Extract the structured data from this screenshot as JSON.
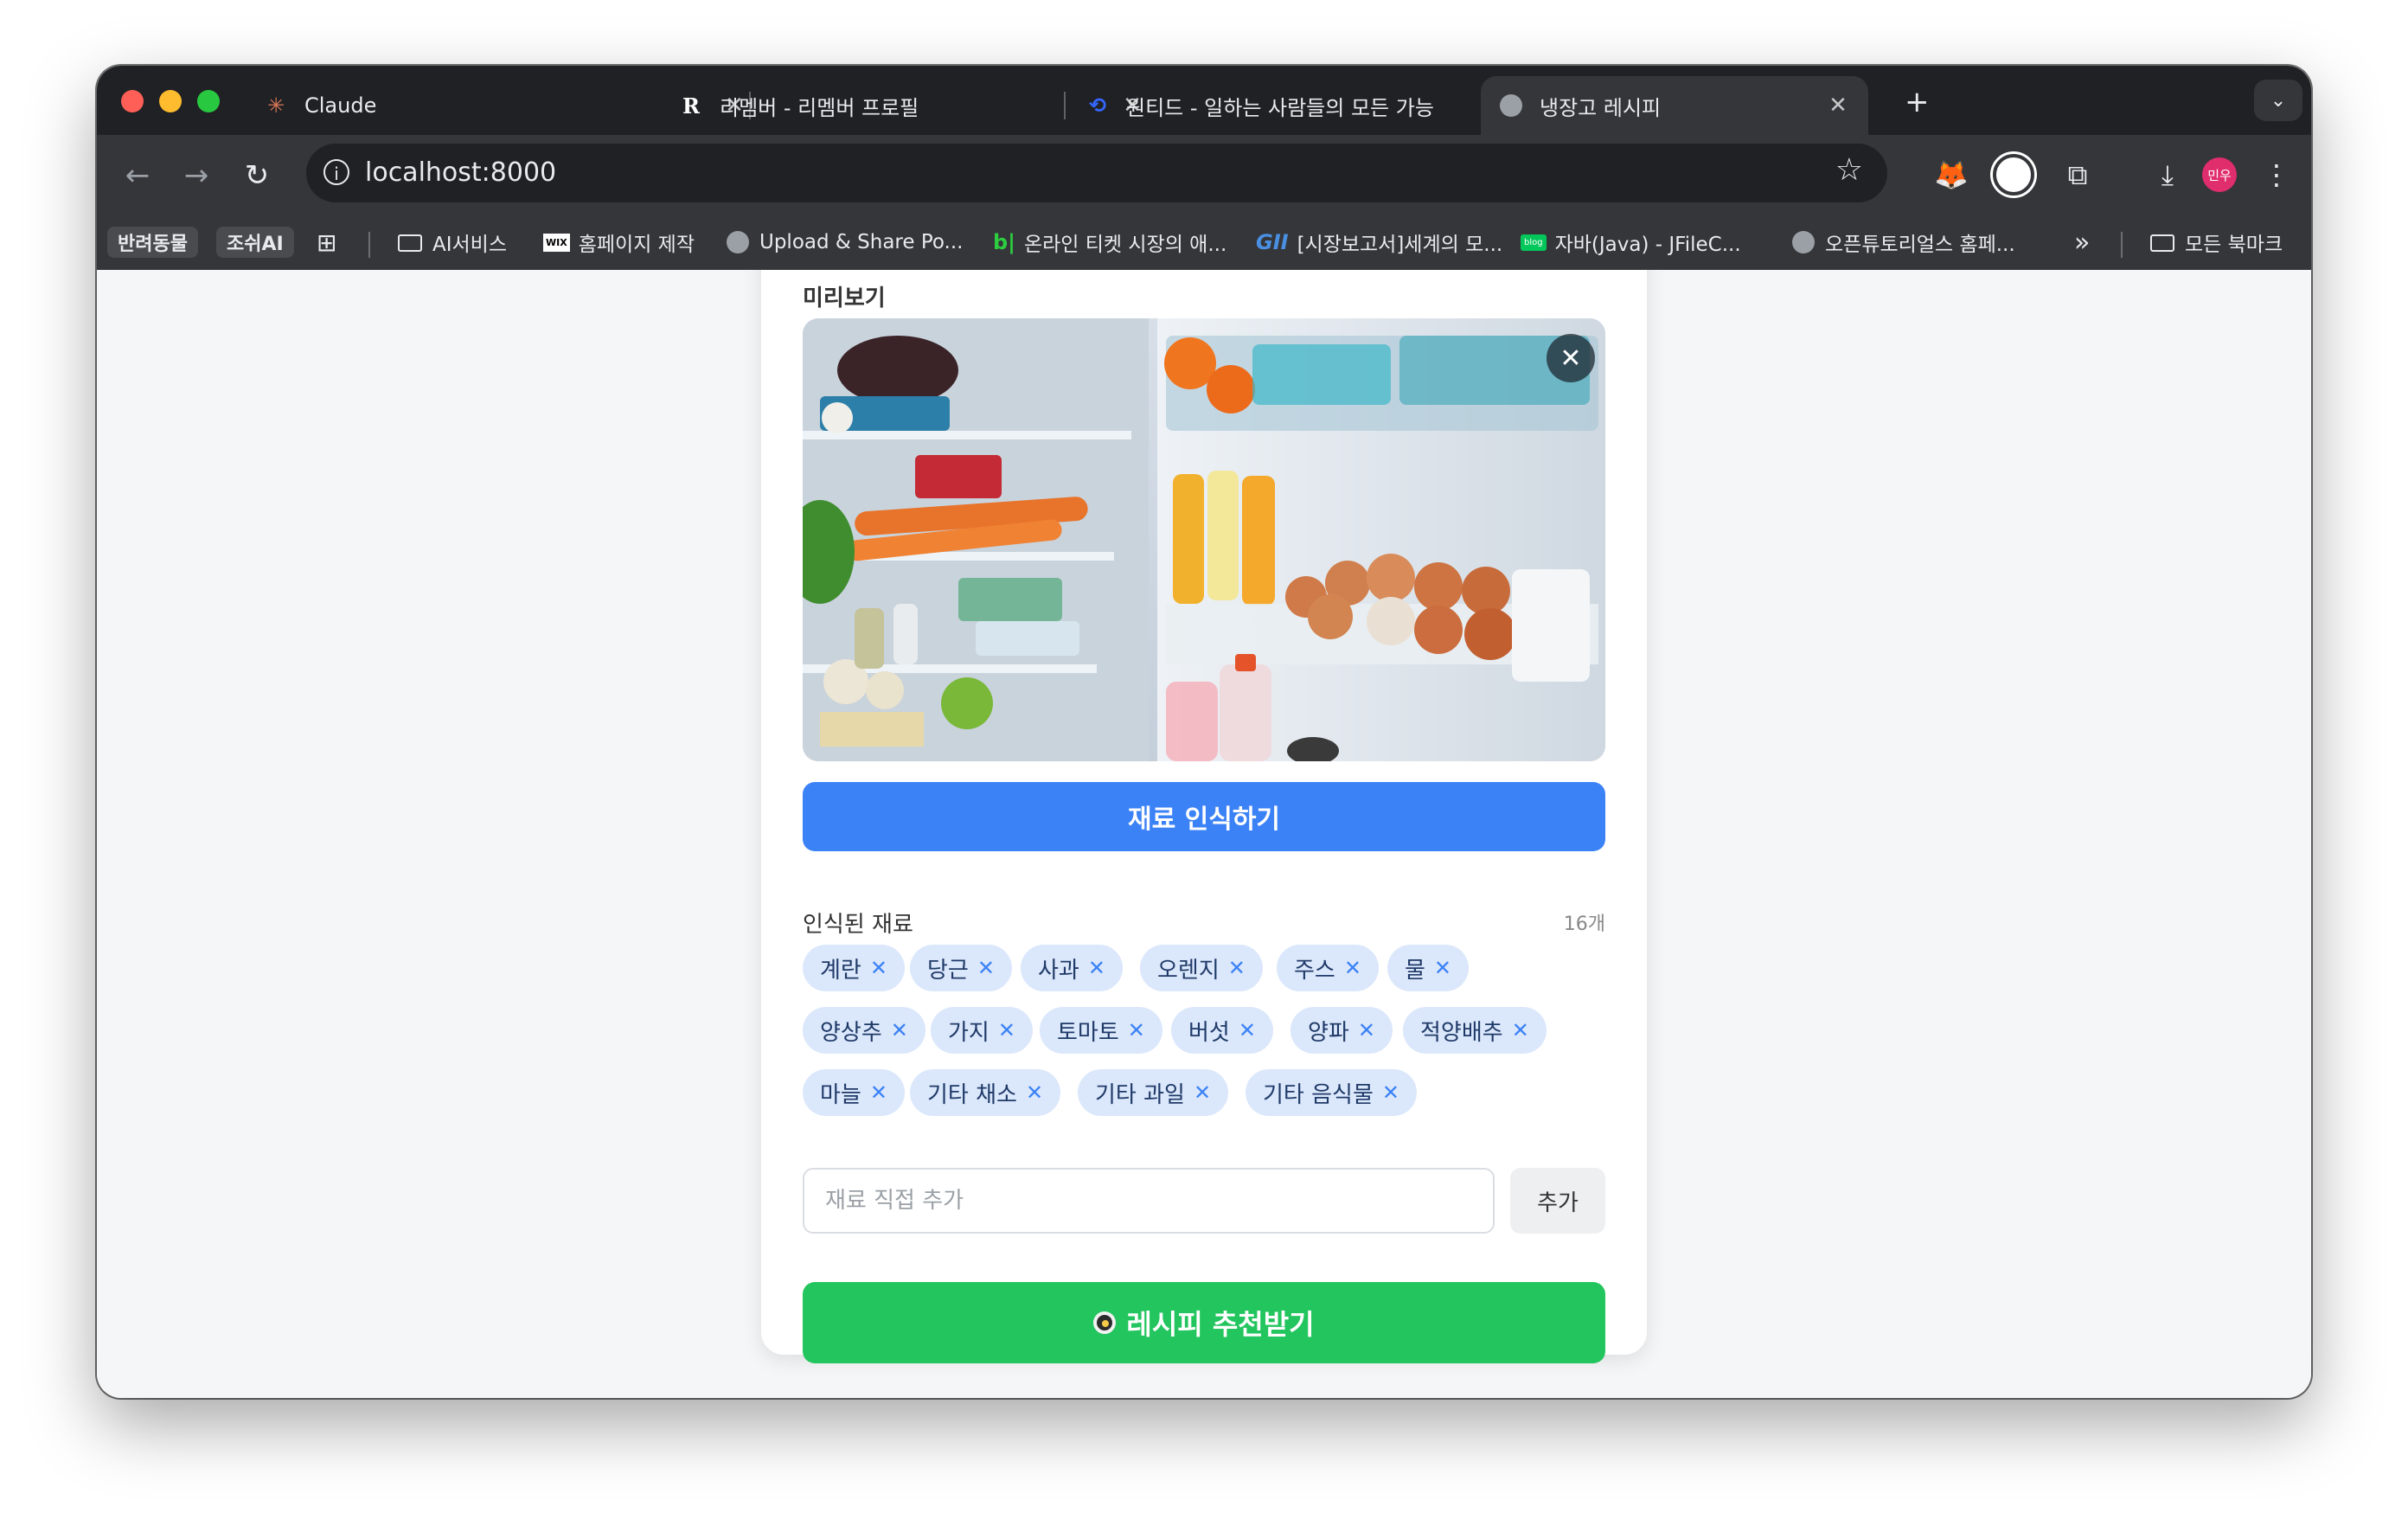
{
  "tabs": [
    {
      "title": "Claude",
      "icon": "claude-icon"
    },
    {
      "title": "리멤버 - 리멤버 프로필",
      "icon": "remember-icon"
    },
    {
      "title": "원티드 - 일하는 사람들의 모든 가능",
      "icon": "wanted-icon"
    },
    {
      "title": "냉장고 레시피",
      "icon": "globe-icon",
      "active": true
    }
  ],
  "toolbar": {
    "url": "localhost:8000",
    "avatar_label": "민우"
  },
  "bookmarks": {
    "pill1": "반려동물",
    "pill2": "조쉬AI",
    "items": [
      "AI서비스",
      "홈페이지 제작",
      "Upload & Share Po...",
      "온라인 티켓 시장의 애...",
      "[시장보고서]세계의 모...",
      "자바(Java) - JFileC...",
      "오픈튜토리얼스 홈페..."
    ],
    "overflow": "»",
    "all": "모든 북마크"
  },
  "page": {
    "preview_label": "미리보기",
    "recognize_button": "재료 인식하기",
    "ingredients_title": "인식된 재료",
    "ingredients_count": "16개",
    "ingredients": [
      "계란",
      "당근",
      "사과",
      "오렌지",
      "주스",
      "물",
      "양상추",
      "가지",
      "토마토",
      "버섯",
      "양파",
      "적양배추",
      "마늘",
      "기타 채소",
      "기타 과일",
      "기타 음식물"
    ],
    "add_placeholder": "재료 직접 추가",
    "add_button": "추가",
    "recommend_button": "레시피 추천받기"
  }
}
